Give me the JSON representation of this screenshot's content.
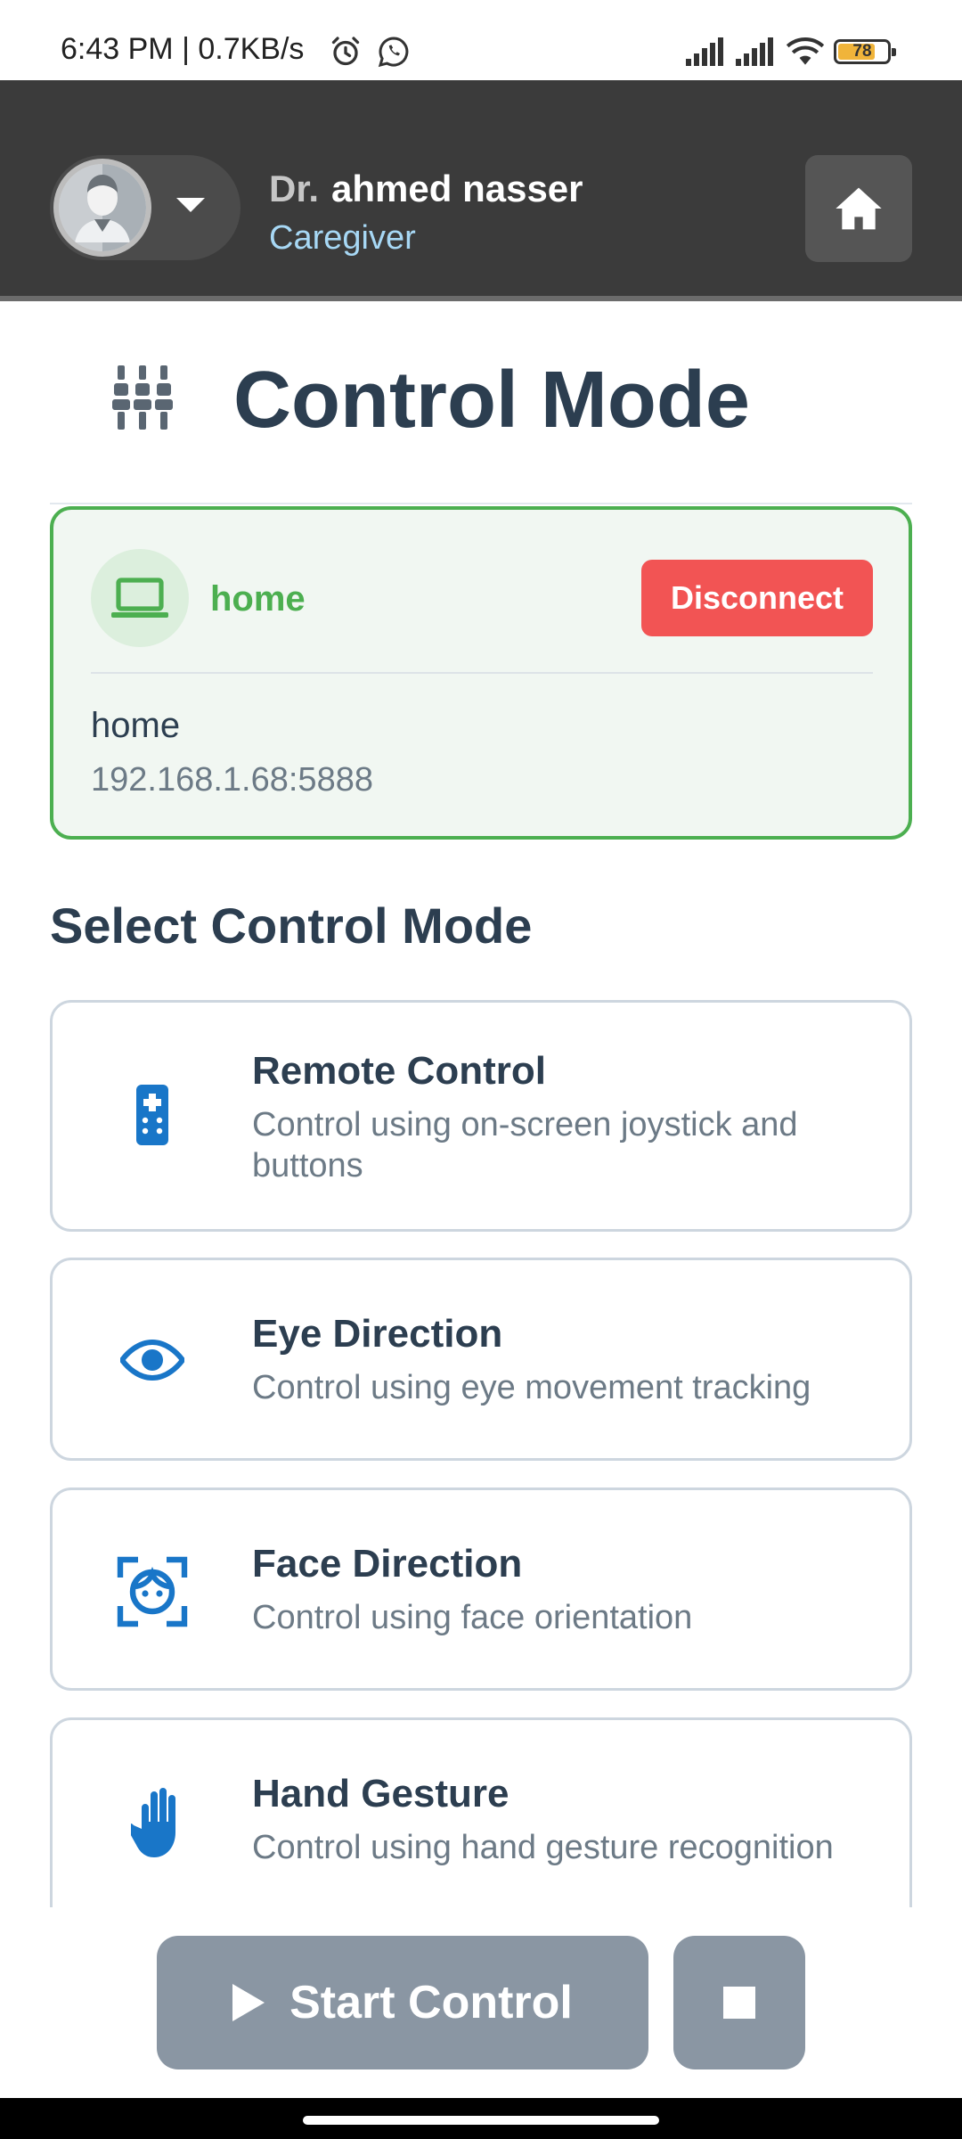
{
  "status_bar": {
    "time_and_speed": "6:43 PM | 0.7KB/s",
    "battery_level": "78",
    "battery_fill_fraction": 0.78,
    "icons": [
      "alarm-icon",
      "whatsapp-icon",
      "signal-icon",
      "signal-icon",
      "wifi-icon",
      "battery-icon"
    ]
  },
  "header": {
    "user_title": "Dr.",
    "user_name": "ahmed nasser",
    "user_role": "Caregiver",
    "icons": [
      "avatar",
      "chevron-down-icon",
      "home-icon"
    ]
  },
  "page": {
    "title": "Control Mode",
    "title_icon": "sliders-icon"
  },
  "connection": {
    "device_label": "home",
    "disconnect_label": "Disconnect",
    "host_name": "home",
    "address": "192.168.1.68:5888",
    "icon": "laptop-icon"
  },
  "section": {
    "title": "Select Control Mode"
  },
  "modes": [
    {
      "name": "Remote Control",
      "description": "Control using on-screen joystick and buttons",
      "icon": "remote-icon"
    },
    {
      "name": "Eye Direction",
      "description": "Control using eye movement tracking",
      "icon": "eye-icon"
    },
    {
      "name": "Face Direction",
      "description": "Control using face orientation",
      "icon": "face-scan-icon"
    },
    {
      "name": "Hand Gesture",
      "description": "Control using hand gesture recognition",
      "icon": "hand-icon"
    }
  ],
  "actions": {
    "start_label": "Start Control",
    "start_icon": "play-icon",
    "stop_icon": "stop-icon"
  },
  "colors": {
    "header_bg": "#3b3b3b",
    "accent_blue": "#1976c8",
    "connected_green": "#4caf50",
    "disconnect_red": "#f25454",
    "disabled_gray": "#8a96a3",
    "text_dark": "#2c3e50"
  }
}
